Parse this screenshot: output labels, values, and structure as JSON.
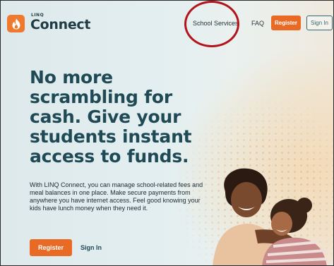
{
  "header": {
    "logo_small": "LINQ",
    "logo_big": "Connect",
    "nav": {
      "school_services": "School Services",
      "faq": "FAQ",
      "register": "Register",
      "sign_in": "Sign In"
    }
  },
  "hero": {
    "headline": "No more scrambling for cash. Give your students instant access to funds.",
    "body": "With LINQ Connect, you can manage school-related fees and meal balances in one place. Make secure payments from anywhere you have internet access. Feel good knowing your kids have lunch money when they need it.",
    "register_label": "Register",
    "sign_in_label": "Sign In"
  },
  "colors": {
    "accent": "#e86a25",
    "brand_dark": "#1f4a55",
    "annotation": "#b3141b"
  },
  "icons": {
    "logo": "flame-icon"
  }
}
